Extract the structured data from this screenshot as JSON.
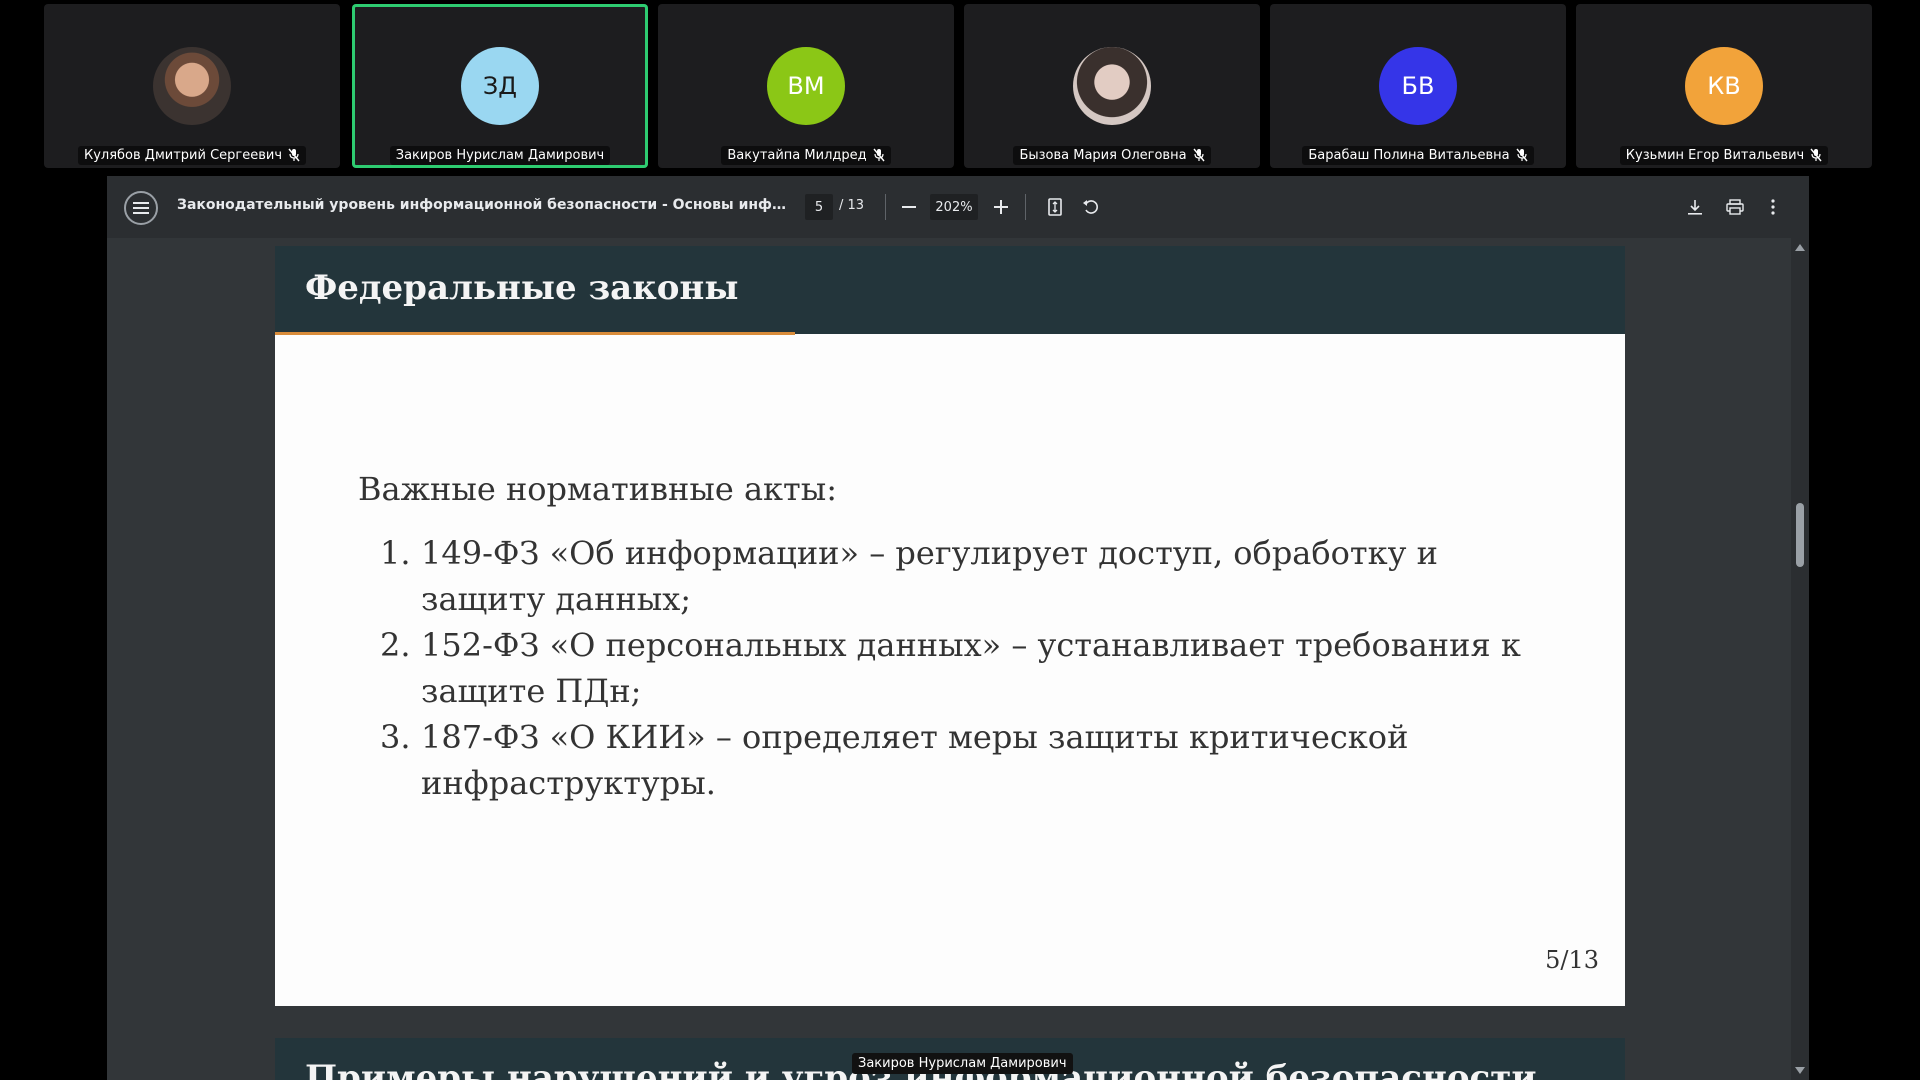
{
  "participants": [
    {
      "name": "Кулябов Дмитрий Сергеевич",
      "initials": "",
      "avatar_color": "",
      "muted": true,
      "active": false
    },
    {
      "name": "Закиров Нурислам Дамирович",
      "initials": "ЗД",
      "avatar_color": "#9ad7f1",
      "muted": false,
      "active": true
    },
    {
      "name": "Вакутайпа Милдред",
      "initials": "ВМ",
      "avatar_color": "#8bc716",
      "muted": true,
      "active": false
    },
    {
      "name": "Бызова Мария Олеговна",
      "initials": "",
      "avatar_color": "",
      "muted": true,
      "active": false
    },
    {
      "name": "Барабаш Полина Витальевна",
      "initials": "БВ",
      "avatar_color": "#3535e8",
      "muted": true,
      "active": false
    },
    {
      "name": "Кузьмин Егор Витальевич",
      "initials": "КВ",
      "avatar_color": "#f2a33a",
      "muted": true,
      "active": false
    }
  ],
  "viewer": {
    "title": "Законодательный уровень информационной безопасности - Основы информац...",
    "page_current": "5",
    "page_total": "/ 13",
    "zoom": "202%"
  },
  "slide": {
    "title": "Федеральные законы",
    "intro": "Важные нормативные акты:",
    "items": [
      {
        "num": "1.",
        "text": "149-ФЗ «Об информации» – регулирует доступ, обработку и защиту данных;"
      },
      {
        "num": "2.",
        "text": "152-ФЗ «О персональных данных» – устанавливает требования к защите ПДн;"
      },
      {
        "num": "3.",
        "text": "187-ФЗ «О КИИ» – определяет меры защиты критической инфраструктуры."
      }
    ],
    "page_label": "5/13"
  },
  "next_slide": {
    "title_partial": "Примеры нарушений и угроз информационной безопасности"
  },
  "speaker_label": "Закиров Нурислам Дамирович",
  "colors": {
    "active_border": "#2ecc71",
    "slide_header": "#23353b",
    "slide_accent": "#d98c3a"
  }
}
